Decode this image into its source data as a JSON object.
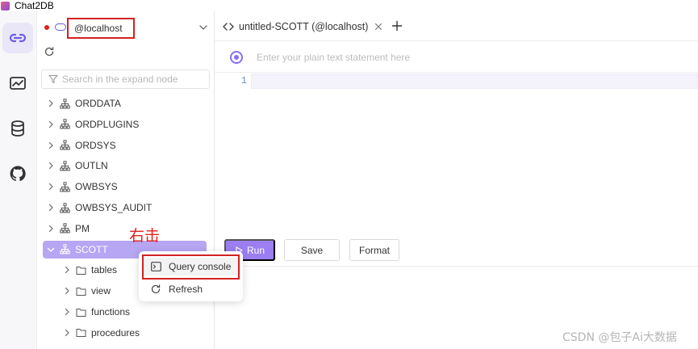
{
  "app": {
    "title": "Chat2DB"
  },
  "activity_bar": {
    "items": [
      {
        "icon": "connection-icon",
        "active": true
      },
      {
        "icon": "dashboard-chart-icon",
        "active": false
      },
      {
        "icon": "database-icon",
        "active": false
      },
      {
        "icon": "github-icon",
        "active": false
      }
    ]
  },
  "connection": {
    "name": "@localhost",
    "status_color": "#e02020"
  },
  "tree": {
    "search_placeholder": "Search in the expand node",
    "items": [
      {
        "label": "ORDDATA"
      },
      {
        "label": "ORDPLUGINS"
      },
      {
        "label": "ORDSYS"
      },
      {
        "label": "OUTLN"
      },
      {
        "label": "OWBSYS"
      },
      {
        "label": "OWBSYS_AUDIT"
      },
      {
        "label": "PM"
      },
      {
        "label": "SCOTT"
      }
    ],
    "children": [
      {
        "label": "tables"
      },
      {
        "label": "view"
      },
      {
        "label": "functions"
      },
      {
        "label": "procedures"
      }
    ]
  },
  "tabs": {
    "items": [
      {
        "label": "untitled-SCOTT (@localhost)"
      }
    ]
  },
  "editor": {
    "prompt_placeholder": "Enter your plain text statement here",
    "line_number": "1"
  },
  "actions": {
    "run": "Run",
    "save": "Save",
    "format": "Format"
  },
  "context_menu": {
    "items": [
      {
        "label": "Query console"
      },
      {
        "label": "Refresh"
      }
    ]
  },
  "annotation": "右击",
  "watermark": "CSDN @包子Ai大数据",
  "colors": {
    "accent": "#9b7ff0",
    "selected": "#b6a6f3",
    "highlight_border": "#d42121"
  }
}
